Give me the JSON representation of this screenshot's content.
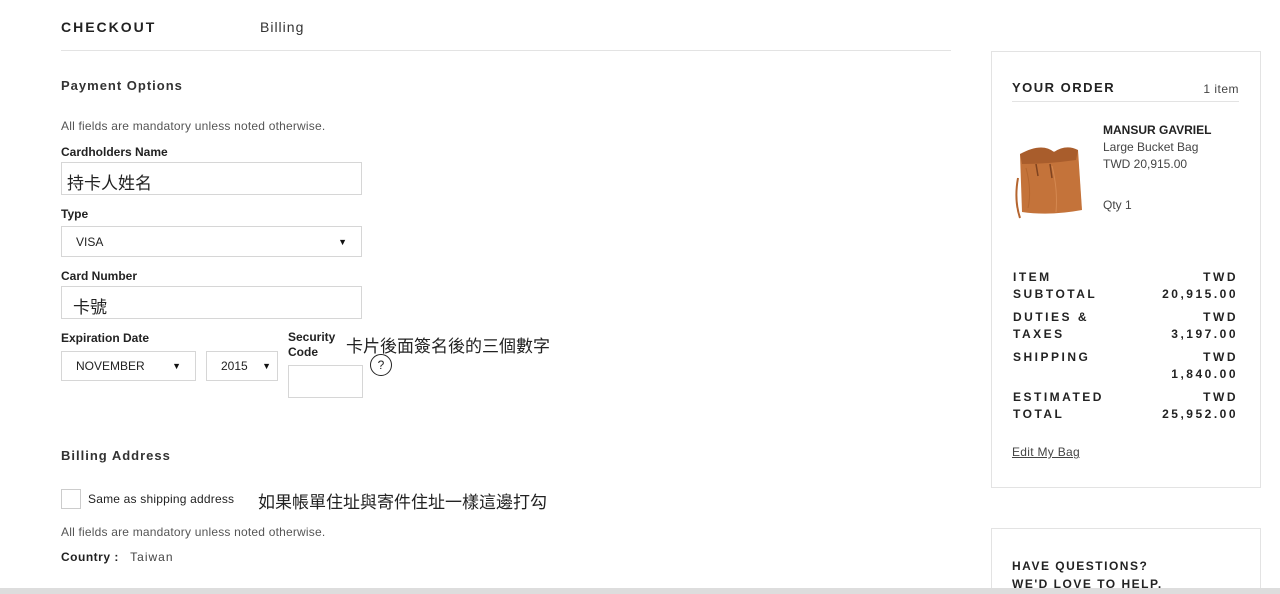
{
  "header": {
    "title": "CHECKOUT",
    "step": "Billing"
  },
  "payment": {
    "section_title": "Payment Options",
    "mandatory_note": "All fields are mandatory unless noted otherwise.",
    "cardholder_label": "Cardholders Name",
    "cardholder_value": "持卡人姓名",
    "type_label": "Type",
    "type_value": "VISA",
    "card_number_label": "Card Number",
    "card_number_value": "卡號",
    "expiration_label": "Expiration Date",
    "exp_month": "NOVEMBER",
    "exp_year": "2015",
    "security_label_1": "Security",
    "security_label_2": "Code",
    "security_value": "",
    "security_annotation": "卡片後面簽名後的三個數字",
    "help_symbol": "?"
  },
  "billing": {
    "section_title": "Billing Address",
    "same_as_shipping_label": "Same as shipping address",
    "same_as_shipping_checked": false,
    "same_annotation": "如果帳單住址與寄件住址一樣這邊打勾",
    "mandatory_note": "All fields are mandatory unless noted otherwise.",
    "country_label": "Country :",
    "country_value": "Taiwan"
  },
  "order": {
    "title": "YOUR ORDER",
    "count": "1 item",
    "product": {
      "brand": "MANSUR GAVRIEL",
      "name": "Large Bucket Bag",
      "price": "TWD 20,915.00",
      "qty": "Qty 1",
      "image_icon": "bucket-bag-image",
      "color": "#c4733a"
    },
    "summary": [
      {
        "label_1": "ITEM",
        "label_2": "SUBTOTAL",
        "value_1": "TWD",
        "value_2": "20,915.00"
      },
      {
        "label_1": "DUTIES &",
        "label_2": "TAXES",
        "value_1": "TWD",
        "value_2": "3,197.00"
      },
      {
        "label_1": "SHIPPING",
        "label_2": "",
        "value_1": "TWD",
        "value_2": "1,840.00"
      },
      {
        "label_1": "ESTIMATED",
        "label_2": "TOTAL",
        "value_1": "TWD",
        "value_2": "25,952.00"
      }
    ],
    "edit_link": "Edit My Bag"
  },
  "questions": {
    "line_1": "HAVE QUESTIONS?",
    "line_2": "WE'D LOVE TO HELP."
  }
}
